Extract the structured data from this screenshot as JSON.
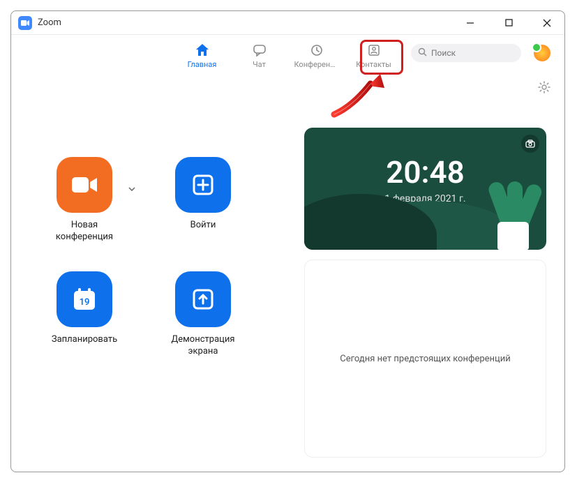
{
  "window": {
    "title": "Zoom"
  },
  "tabs": {
    "home": "Главная",
    "chat": "Чат",
    "meetings": "Конференц...",
    "contacts": "Контакты"
  },
  "search": {
    "placeholder": "Поиск"
  },
  "actions": {
    "new_meeting": "Новая\nконференция",
    "join": "Войти",
    "schedule": "Запланировать",
    "schedule_day": "19",
    "share_screen": "Демонстрация\nэкрана"
  },
  "clock": {
    "time": "20:48",
    "date": "1 февраля 2021 г."
  },
  "status": {
    "no_upcoming": "Сегодня нет предстоящих конференций"
  },
  "colors": {
    "accent_blue": "#0e71eb",
    "accent_orange": "#f26d21",
    "highlight_red": "#d01f1f"
  }
}
